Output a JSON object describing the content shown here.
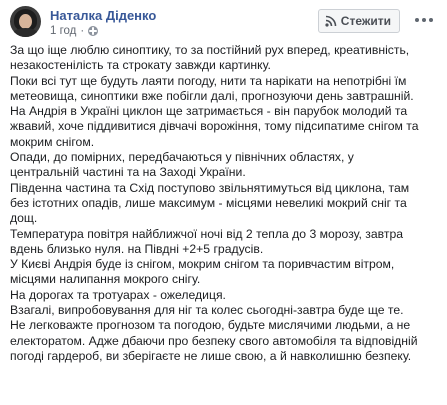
{
  "post": {
    "author": "Наталка Діденко",
    "time": "1 год",
    "privacy_icon": "globe-icon",
    "follow_label": "Стежити",
    "follow_icon": "rss-icon",
    "more_icon": "more-dots-icon",
    "colors": {
      "author": "#385898",
      "text": "#1c1e21",
      "meta": "#616770"
    },
    "lines": [
      "За що іще люблю синоптику, то за постійний рух вперед, креативність,",
      "незакостенілість та строкату завжди картинку.",
      "Поки всі тут ще будуть лаяти погоду, нити та нарікати на непотрібні їм",
      "метеовища, синоптики вже побігли далі, прогнозуючи день завтрашній.",
      "На Андрія в Україні циклон ще затримається - він парубок молодий та",
      "жвавий, хоче піддивитися дівчачі ворожіння, тому підсипатиме снігом та",
      "мокрим снігом.",
      "Опади, до помірних, передбачаються у північних областях, у",
      "центральній частині та на Заході України.",
      "Південна частина та Схід поступово звільнятимуться від циклона, там",
      "без істотних опадів, лише максимум - місцями невеликі мокрий сніг та",
      "дощ.",
      "Температура повітря найближчої ночі від 2 тепла до 3 морозу, завтра",
      "вдень близько нуля. на Півдні +2+5 градусів.",
      "У Києві Андрія буде із снігом, мокрим снігом та поривчастим вітром,",
      "місцями налипання мокрого снігу.",
      "На дорогах та тротуарах - ожеледиця.",
      "Взагалі, випробовування для ніг та колес сьогодні-завтра буде ще те.",
      "Не легковажте прогнозом та погодою, будьте мислячими людьми, а не",
      "електоратом. Адже дбаючи про безпеку свого автомобіля та відповідній",
      "погоді гардероб, ви зберігаєте не лише свою, а й навколишню безпеку."
    ]
  }
}
